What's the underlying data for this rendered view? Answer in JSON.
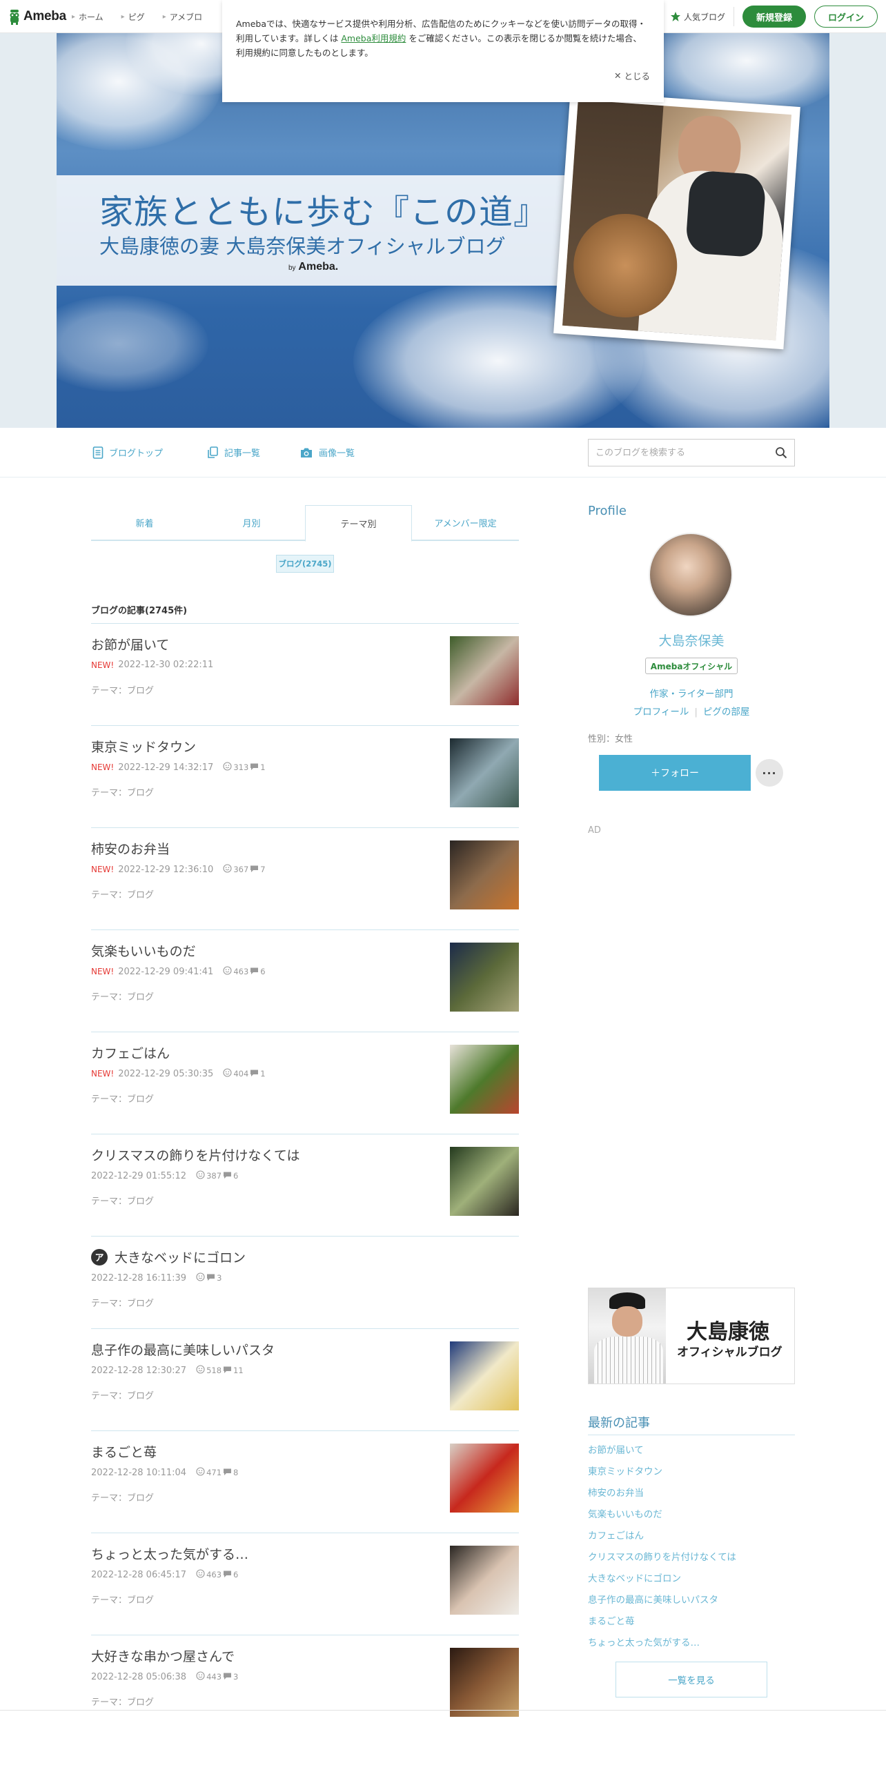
{
  "topbar": {
    "logo_text": "Ameba",
    "nav": [
      "ホーム",
      "ピグ",
      "アメブロ"
    ],
    "popular_blog": "人気ブログ",
    "register": "新規登録",
    "login": "ログイン"
  },
  "cookie": {
    "text_before": "Amebaでは、快適なサービス提供や利用分析、広告配信のためにクッキーなどを使い訪問データの取得・利用しています。詳しくは",
    "link": "Ameba利用規約",
    "text_after": "をご確認ください。この表示を閉じるか閲覧を続けた場合、利用規約に同意したものとします。",
    "close": "とじる"
  },
  "header": {
    "title": "家族とともに歩む『この道』",
    "subtitle": "大島康徳の妻 大島奈保美オフィシャルブログ",
    "by": "by",
    "by_brand": "Ameba."
  },
  "blognav": {
    "top": "ブログトップ",
    "articles": "記事一覧",
    "images": "画像一覧",
    "search_placeholder": "このブログを検索する"
  },
  "tabs": [
    "新着",
    "月別",
    "テーマ別",
    "アメンバー限定"
  ],
  "theme_tag": "ブログ(2745)",
  "list_heading": "ブログの記事(2745件)",
  "articles": [
    {
      "title": "お節が届いて",
      "new": "NEW!",
      "date": "2022-12-30 02:22:11",
      "likes": "",
      "comments": "",
      "theme": "テーマ：ブログ",
      "thumb": [
        "#3e5c2a",
        "#c7b7a5",
        "#8f2d2d"
      ]
    },
    {
      "title": "東京ミッドタウン",
      "new": "NEW!",
      "date": "2022-12-29 14:32:17",
      "likes": "313",
      "comments": "1",
      "theme": "テーマ：ブログ",
      "thumb": [
        "#1c2a30",
        "#90a9b2",
        "#3f5b52"
      ]
    },
    {
      "title": "柿安のお弁当",
      "new": "NEW!",
      "date": "2022-12-29 12:36:10",
      "likes": "367",
      "comments": "7",
      "theme": "テーマ：ブログ",
      "thumb": [
        "#2a2522",
        "#8d6b4c",
        "#c9742c"
      ]
    },
    {
      "title": "気楽もいいものだ",
      "new": "NEW!",
      "date": "2022-12-29 09:41:41",
      "likes": "463",
      "comments": "6",
      "theme": "テーマ：ブログ",
      "thumb": [
        "#1c2b4a",
        "#5c6a3a",
        "#a7a47a"
      ]
    },
    {
      "title": "カフェごはん",
      "new": "NEW!",
      "date": "2022-12-29 05:30:35",
      "likes": "404",
      "comments": "1",
      "theme": "テーマ：ブログ",
      "thumb": [
        "#e8e2da",
        "#4e7a2c",
        "#b9452e"
      ]
    },
    {
      "title": "クリスマスの飾りを片付けなくては",
      "new": "",
      "date": "2022-12-29 01:55:12",
      "likes": "387",
      "comments": "6",
      "theme": "テーマ：ブログ",
      "thumb": [
        "#243a1e",
        "#9fb07a",
        "#2a2620"
      ]
    },
    {
      "title": "大きなベッドにゴロン",
      "new": "",
      "date": "2022-12-28 16:11:39",
      "likes": "",
      "comments": "3",
      "theme": "テーマ：ブログ",
      "thumb": []
    },
    {
      "title": "息子作の最高に美味しいパスタ",
      "new": "",
      "date": "2022-12-28 12:30:27",
      "likes": "518",
      "comments": "11",
      "theme": "テーマ：ブログ",
      "thumb": [
        "#1f3a7a",
        "#f1e9c8",
        "#e2c25a"
      ]
    },
    {
      "title": "まるごと苺",
      "new": "",
      "date": "2022-12-28 10:11:04",
      "likes": "471",
      "comments": "8",
      "theme": "テーマ：ブログ",
      "thumb": [
        "#d8d0c6",
        "#c7281d",
        "#e9a33a"
      ]
    },
    {
      "title": "ちょっと太った気がする…",
      "new": "",
      "date": "2022-12-28 06:45:17",
      "likes": "463",
      "comments": "6",
      "theme": "テーマ：ブログ",
      "thumb": [
        "#2a2622",
        "#d9c3b1",
        "#efede8"
      ]
    },
    {
      "title": "大好きな串かつ屋さんで",
      "new": "",
      "date": "2022-12-28 05:06:38",
      "likes": "443",
      "comments": "3",
      "theme": "テーマ：ブログ",
      "thumb": [
        "#2b1a12",
        "#8a5a36",
        "#c8a26a"
      ]
    }
  ],
  "sidebar": {
    "profile_title": "Profile",
    "name": "大島奈保美",
    "badge": "Amebaオフィシャル",
    "category": "作家・ライター部門",
    "link_profile": "プロフィール",
    "link_room": "ピグの部屋",
    "gender": "性別：女性",
    "follow": "＋フォロー",
    "more": "···",
    "ad": "AD",
    "banner_line1": "大島康徳",
    "banner_line2": "オフィシャルブログ",
    "recent_title": "最新の記事",
    "recent": [
      "お節が届いて",
      "東京ミッドタウン",
      "柿安のお弁当",
      "気楽もいいものだ",
      "カフェごはん",
      "クリスマスの飾りを片付けなくては",
      "大きなベッドにゴロン",
      "息子作の最高に美味しいパスタ",
      "まるごと苺",
      "ちょっと太った気がする…"
    ],
    "more_link": "一覧を見る"
  },
  "colors": {
    "brand_green": "#2d8c3c",
    "link_blue": "#4aa6c8",
    "new_red": "#e53935"
  }
}
